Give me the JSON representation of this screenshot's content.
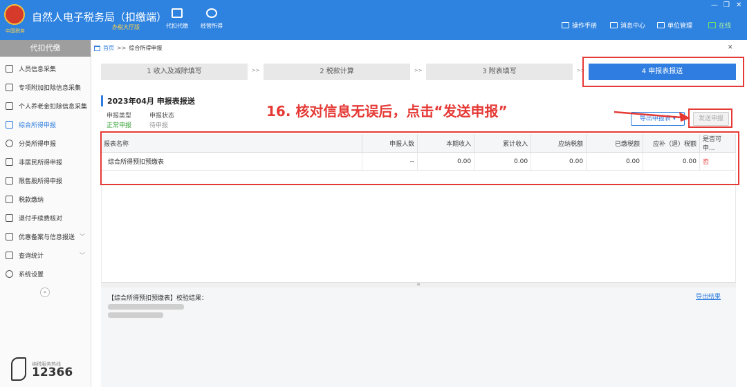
{
  "header": {
    "title": "自然人电子税务局（扣缴端）",
    "subtitle": "办税大厅版",
    "tabs": [
      {
        "label": "代扣代缴",
        "icon": "document-icon"
      },
      {
        "label": "经营所得",
        "icon": "coins-icon"
      }
    ],
    "links": [
      {
        "label": "操作手册",
        "icon": "book-icon"
      },
      {
        "label": "消息中心",
        "icon": "mail-icon"
      },
      {
        "label": "单位管理",
        "icon": "building-icon"
      },
      {
        "label": "在线",
        "icon": "monitor-icon"
      }
    ],
    "window_controls": [
      "—",
      "❐",
      "✕"
    ]
  },
  "sidebar": {
    "title": "代扣代缴",
    "items": [
      {
        "label": "人员信息采集",
        "icon": "person-icon"
      },
      {
        "label": "专项附加扣除信息采集",
        "icon": "list-icon"
      },
      {
        "label": "个人养老金扣除信息采集",
        "icon": "pension-icon"
      },
      {
        "label": "综合所得申报",
        "icon": "layers-icon",
        "active": true
      },
      {
        "label": "分类所得申报",
        "icon": "pie-icon"
      },
      {
        "label": "非居民所得申报",
        "icon": "person-outline-icon"
      },
      {
        "label": "限售股所得申报",
        "icon": "bar-chart-icon"
      },
      {
        "label": "税款缴纳",
        "icon": "folder-icon"
      },
      {
        "label": "退付手续费核对",
        "icon": "receipt-icon"
      },
      {
        "label": "优惠备案与信息报送",
        "icon": "file-icon",
        "expandable": true
      },
      {
        "label": "查询统计",
        "icon": "search-list-icon",
        "expandable": true
      },
      {
        "label": "系统设置",
        "icon": "gear-icon"
      }
    ],
    "collapse": "«",
    "hotline_label": "纳税服务热线",
    "hotline_number": "12366"
  },
  "breadcrumb": {
    "home": "首页",
    "sep": ">>",
    "current": "综合所得申报"
  },
  "steps": [
    {
      "label": "1 收入及减除填写"
    },
    {
      "label": "2 税款计算"
    },
    {
      "label": "3 附表填写"
    },
    {
      "label": "4 申报表报送",
      "active": true
    }
  ],
  "step_sep": ">>",
  "form": {
    "title": "2023年04月  申报表报送",
    "declare_type_label": "申报类型",
    "declare_type_value": "正常申报",
    "declare_status_label": "申报状态",
    "declare_status_value": "待申报",
    "export_button": "导出申报表",
    "export_caret": "▾",
    "send_button": "发送申报"
  },
  "table": {
    "headers": [
      "报表名称",
      "申报人数",
      "本期收入",
      "累计收入",
      "应纳税额",
      "已缴税额",
      "应补（退）税额",
      "是否可申..."
    ],
    "rows": [
      [
        "综合所得预扣预缴表",
        "--",
        "0.00",
        "0.00",
        "0.00",
        "0.00",
        "0.00",
        "否"
      ]
    ]
  },
  "result": {
    "label": "【综合所得预扣预缴表】校验结果：",
    "export_link": "导出结果"
  },
  "annotation": {
    "text": "16. 核对信息无误后，点击“发送申报”",
    "color": "#e53935"
  }
}
